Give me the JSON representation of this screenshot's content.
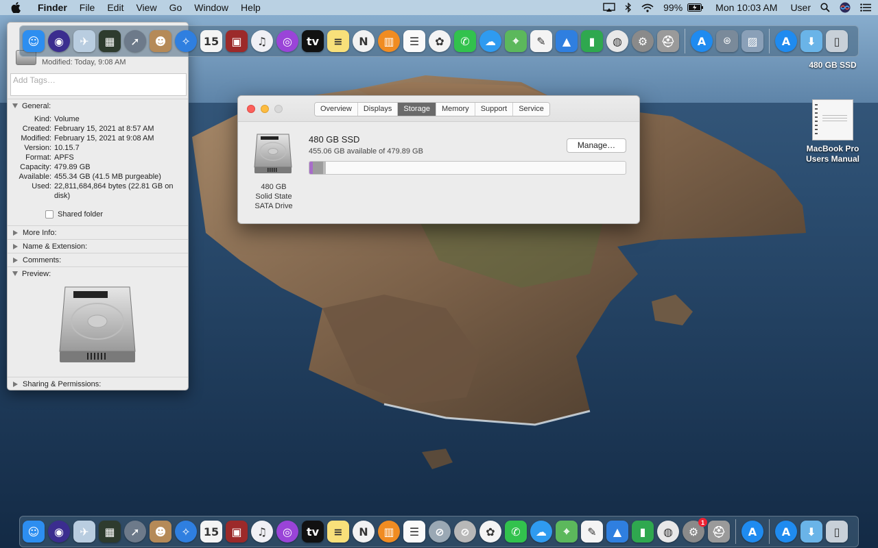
{
  "menubar": {
    "app_name": "Finder",
    "items": [
      "File",
      "Edit",
      "View",
      "Go",
      "Window",
      "Help"
    ],
    "battery": "99%",
    "clock": "Mon 10:03 AM",
    "user": "User"
  },
  "desktop": {
    "drive_label": "480 GB SSD",
    "manual_label": "MacBook Pro Users Manual"
  },
  "info_window": {
    "modified_line": "Modified: Today, 9:08 AM",
    "tags_placeholder": "Add Tags…",
    "general_title": "General:",
    "general": {
      "kind_k": "Kind:",
      "kind_v": "Volume",
      "created_k": "Created:",
      "created_v": "February 15, 2021 at 8:57 AM",
      "modified_k": "Modified:",
      "modified_v": "February 15, 2021 at 9:08 AM",
      "version_k": "Version:",
      "version_v": "10.15.7",
      "format_k": "Format:",
      "format_v": "APFS",
      "capacity_k": "Capacity:",
      "capacity_v": "479.89 GB",
      "available_k": "Available:",
      "available_v": "455.34 GB (41.5 MB purgeable)",
      "used_k": "Used:",
      "used_v": "22,811,684,864 bytes (22.81 GB on disk)"
    },
    "shared_folder": "Shared folder",
    "more_info": "More Info:",
    "name_ext": "Name & Extension:",
    "comments": "Comments:",
    "preview": "Preview:",
    "sharing": "Sharing & Permissions:"
  },
  "about_window": {
    "tabs": [
      "Overview",
      "Displays",
      "Storage",
      "Memory",
      "Support",
      "Service"
    ],
    "active_tab": "Storage",
    "drive_caption_1": "480 GB",
    "drive_caption_2": "Solid State",
    "drive_caption_3": "SATA Drive",
    "ssd_name": "480 GB SSD",
    "ssd_available": "455.06 GB available of 479.89 GB",
    "manage_label": "Manage…",
    "used_fraction": 0.052
  },
  "dock_top": [
    {
      "name": "finder",
      "glyph": "☺",
      "color": "#2d8ef0"
    },
    {
      "name": "siri",
      "glyph": "◉",
      "color": "#3b2d8f",
      "round": true
    },
    {
      "name": "preview-app",
      "glyph": "✈",
      "color": "#b9cde0"
    },
    {
      "name": "activity-monitor",
      "glyph": "▦",
      "color": "#2e3b2e"
    },
    {
      "name": "launchpad",
      "glyph": "➚",
      "color": "#6d7a8a",
      "round": true
    },
    {
      "name": "contacts",
      "glyph": "☻",
      "color": "#b58a58"
    },
    {
      "name": "safari",
      "glyph": "✧",
      "color": "#2f7fe0",
      "round": true
    },
    {
      "name": "calendar",
      "glyph": "15",
      "color": "#f4f4f4",
      "dark": true
    },
    {
      "name": "photo-booth",
      "glyph": "▣",
      "color": "#9c2a2a"
    },
    {
      "name": "itunes",
      "glyph": "♫",
      "color": "#f0f0f5",
      "dark": true,
      "round": true
    },
    {
      "name": "podcasts",
      "glyph": "◎",
      "color": "#9a44d8",
      "round": true
    },
    {
      "name": "apple-tv",
      "glyph": "tv",
      "color": "#111111"
    },
    {
      "name": "notes",
      "glyph": "≡",
      "color": "#f8e07a",
      "dark": true
    },
    {
      "name": "news",
      "glyph": "N",
      "color": "#f2f2f2",
      "dark": true,
      "round": true
    },
    {
      "name": "books",
      "glyph": "▥",
      "color": "#f08c22",
      "round": true
    },
    {
      "name": "reminders",
      "glyph": "☰",
      "color": "#fafafa",
      "dark": true
    },
    {
      "name": "photos",
      "glyph": "✿",
      "color": "#f4f4f4",
      "dark": true,
      "round": true
    },
    {
      "name": "facetime",
      "glyph": "✆",
      "color": "#32c24d"
    },
    {
      "name": "messages",
      "glyph": "☁",
      "color": "#2f9bf0",
      "round": true
    },
    {
      "name": "maps",
      "glyph": "⌖",
      "color": "#5cb85c"
    },
    {
      "name": "textedit",
      "glyph": "✎",
      "color": "#f4f4f4",
      "dark": true
    },
    {
      "name": "keynote",
      "glyph": "▲",
      "color": "#2f7fe0"
    },
    {
      "name": "numbers",
      "glyph": "▮",
      "color": "#2fa84f"
    },
    {
      "name": "chrome",
      "glyph": "◍",
      "color": "#e8e8e8",
      "dark": true,
      "round": true
    },
    {
      "name": "system-preferences",
      "glyph": "⚙",
      "color": "#8a8a8a",
      "round": true
    },
    {
      "name": "disk-utility",
      "glyph": "⛑",
      "color": "#9a9a9a"
    },
    {
      "sep": true
    },
    {
      "name": "app-store",
      "glyph": "A",
      "color": "#1f8bf0",
      "round": true
    },
    {
      "name": "screenshot",
      "glyph": "⌾",
      "color": "#7a8a9a"
    },
    {
      "name": "image-capture",
      "glyph": "▨",
      "color": "#8aa0b8"
    },
    {
      "sep": true
    },
    {
      "name": "app-store-2",
      "glyph": "A",
      "color": "#1f8bf0",
      "round": true
    },
    {
      "name": "downloads",
      "glyph": "⬇",
      "color": "#6ab4e8"
    },
    {
      "name": "trash",
      "glyph": "▯",
      "color": "#c8d0d8",
      "dark": true
    }
  ],
  "dock_bottom": [
    {
      "name": "finder",
      "glyph": "☺",
      "color": "#2d8ef0"
    },
    {
      "name": "siri",
      "glyph": "◉",
      "color": "#3b2d8f",
      "round": true
    },
    {
      "name": "preview-app",
      "glyph": "✈",
      "color": "#b9cde0"
    },
    {
      "name": "activity-monitor",
      "glyph": "▦",
      "color": "#2e3b2e"
    },
    {
      "name": "launchpad",
      "glyph": "➚",
      "color": "#6d7a8a",
      "round": true
    },
    {
      "name": "contacts",
      "glyph": "☻",
      "color": "#b58a58"
    },
    {
      "name": "safari",
      "glyph": "✧",
      "color": "#2f7fe0",
      "round": true
    },
    {
      "name": "calendar",
      "glyph": "15",
      "color": "#f4f4f4",
      "dark": true
    },
    {
      "name": "photo-booth",
      "glyph": "▣",
      "color": "#9c2a2a"
    },
    {
      "name": "itunes",
      "glyph": "♫",
      "color": "#f0f0f5",
      "dark": true,
      "round": true
    },
    {
      "name": "podcasts",
      "glyph": "◎",
      "color": "#9a44d8",
      "round": true
    },
    {
      "name": "apple-tv",
      "glyph": "tv",
      "color": "#111111"
    },
    {
      "name": "notes",
      "glyph": "≡",
      "color": "#f8e07a",
      "dark": true
    },
    {
      "name": "news",
      "glyph": "N",
      "color": "#f2f2f2",
      "dark": true,
      "round": true
    },
    {
      "name": "books",
      "glyph": "▥",
      "color": "#f08c22",
      "round": true
    },
    {
      "name": "reminders",
      "glyph": "☰",
      "color": "#fafafa",
      "dark": true
    },
    {
      "name": "prohibited-app",
      "glyph": "⊘",
      "color": "#9aa8b4",
      "round": true
    },
    {
      "name": "prohibited-app-2",
      "glyph": "⊘",
      "color": "#b8b8b8",
      "round": true
    },
    {
      "name": "photos",
      "glyph": "✿",
      "color": "#f4f4f4",
      "dark": true,
      "round": true
    },
    {
      "name": "facetime",
      "glyph": "✆",
      "color": "#32c24d"
    },
    {
      "name": "messages",
      "glyph": "☁",
      "color": "#2f9bf0",
      "round": true
    },
    {
      "name": "maps",
      "glyph": "⌖",
      "color": "#5cb85c"
    },
    {
      "name": "textedit",
      "glyph": "✎",
      "color": "#f4f4f4",
      "dark": true
    },
    {
      "name": "keynote",
      "glyph": "▲",
      "color": "#2f7fe0"
    },
    {
      "name": "numbers",
      "glyph": "▮",
      "color": "#2fa84f"
    },
    {
      "name": "chrome",
      "glyph": "◍",
      "color": "#e8e8e8",
      "dark": true,
      "round": true
    },
    {
      "name": "system-preferences",
      "glyph": "⚙",
      "color": "#8a8a8a",
      "round": true,
      "badge": "1"
    },
    {
      "name": "disk-utility",
      "glyph": "⛑",
      "color": "#9a9a9a"
    },
    {
      "sep": true
    },
    {
      "name": "app-store",
      "glyph": "A",
      "color": "#1f8bf0",
      "round": true
    },
    {
      "sep": true
    },
    {
      "name": "app-store-2",
      "glyph": "A",
      "color": "#1f8bf0",
      "round": true
    },
    {
      "name": "downloads",
      "glyph": "⬇",
      "color": "#6ab4e8"
    },
    {
      "name": "trash",
      "glyph": "▯",
      "color": "#c8d0d8",
      "dark": true
    }
  ]
}
